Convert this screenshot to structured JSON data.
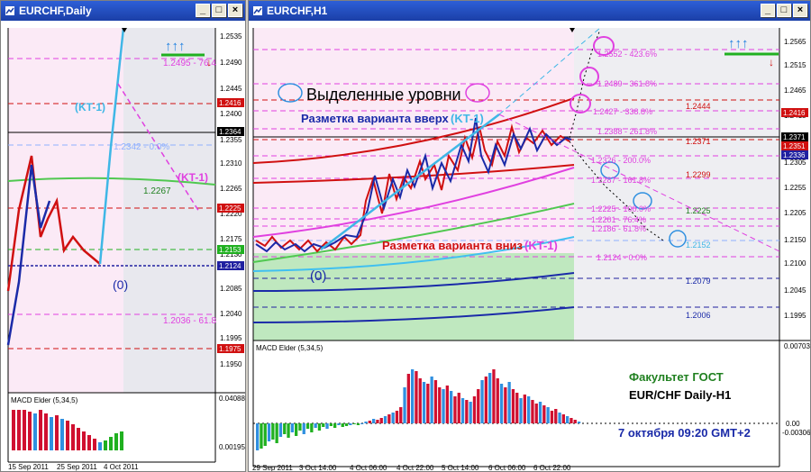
{
  "colors": {
    "title_bar": "#1b3fa7",
    "kt_line": "#3fb7e6",
    "pink_level": "#e040e0",
    "red_level": "#d01010",
    "green_level": "#20b020"
  },
  "window_left": {
    "title": "EURCHF,Daily",
    "buttons": [
      "_",
      "□",
      "×"
    ],
    "price_ticks": [
      "1.2535",
      "1.2490",
      "1.2445",
      "1.2400",
      "1.2355",
      "1.2310",
      "1.2265",
      "1.2220",
      "1.2175",
      "1.2130",
      "1.2085",
      "1.2040",
      "1.1995",
      "1.1950"
    ],
    "price_tags": [
      "1.2416",
      "1.2364",
      "1.2225",
      "1.2153",
      "1.2124",
      "1.1975"
    ],
    "levels": [
      "1.2495 - 76.4",
      "1.2342 - 0.0%",
      "1.2267",
      "1.2036 - 61.8"
    ],
    "labels": {
      "kt_up": "(KT-1)",
      "kt_down": "(KT-1)",
      "zero": "(0)",
      "arrows_up": "↑↑↑",
      "arrow_down": "↓"
    },
    "macd_title": "MACD Elder (5,34,5)",
    "macd_ticks": [
      "0.04088",
      "0.00195"
    ],
    "dates": [
      "15 Sep 2011",
      "25 Sep 2011",
      "4 Oct 2011"
    ]
  },
  "window_right": {
    "title": "EURCHF,H1",
    "buttons": [
      "_",
      "□",
      "×"
    ],
    "price_ticks": [
      "1.2565",
      "1.2515",
      "1.2465",
      "1.2415",
      "1.2355",
      "1.2305",
      "1.2255",
      "1.2205",
      "1.2150",
      "1.2100",
      "1.2045",
      "1.1995"
    ],
    "price_tags": [
      "1.2416",
      "1.2371",
      "1.2351",
      "1.2336"
    ],
    "legend_text": "Выделенные уровни",
    "label_up": "Разметка варианта вверх",
    "label_up_kt": "(KT-1)",
    "label_down": "Разметка варианта вниз",
    "label_down_kt": "(KT-1)",
    "zero": "(0)",
    "fib_levels": [
      "1.2552 - 423.6%",
      "1.2489 - 361.8%",
      "1.2427 - 338.8%",
      "1.2388 - 261.8%",
      "1.2326 - 200.0%",
      "1.2287 - 161.8%",
      "1.2225 - 100.0%",
      "1.2201 - 76.4%",
      "1.2186 - 61.8%",
      "1.2124 - 0.0%"
    ],
    "level_values": [
      "1.2444",
      "1.2371",
      "1.2299",
      "1.2225",
      "1.2152",
      "1.2079",
      "1.2006"
    ],
    "arrows_up": "↑↑↑",
    "arrow_down": "↓",
    "macd_title": "MACD Elder (5,34,5)",
    "macd_ticks": [
      "0.00703",
      "0.00",
      "-0.00306"
    ],
    "notes": [
      "Факультет ГОСТ",
      "EUR/CHF Daily-H1",
      "7 октября 09:20 GMT+2"
    ],
    "dates": [
      "29 Sep 2011",
      "3 Oct 14:00",
      "4 Oct 06:00",
      "4 Oct 22:00",
      "5 Oct 14:00",
      "6 Oct 06:00",
      "6 Oct 22:00"
    ]
  }
}
